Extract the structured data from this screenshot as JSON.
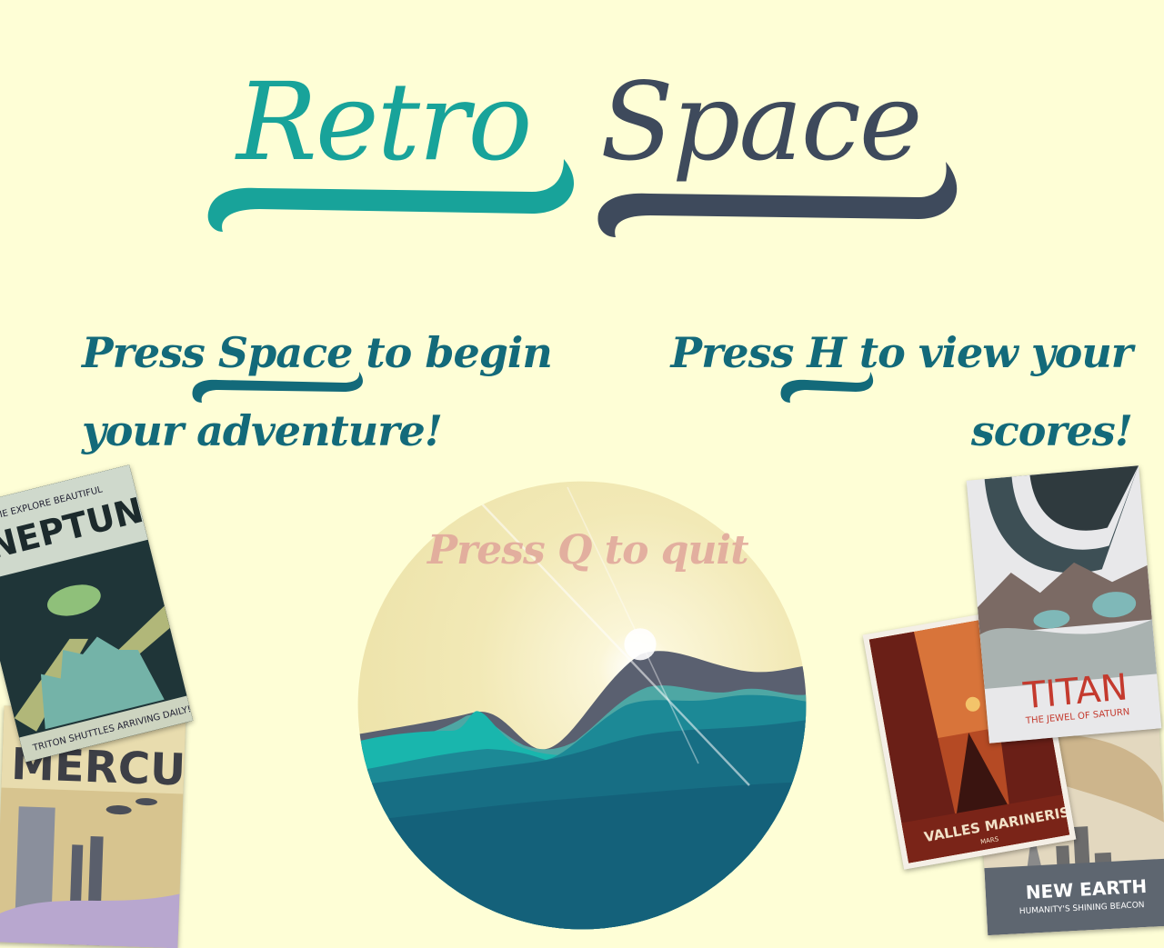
{
  "title": {
    "word1": "Retro",
    "word2": "Space"
  },
  "instructions": {
    "start": {
      "press": "Press",
      "key": "Space",
      "rest_line1": "to begin",
      "line2": "your adventure!"
    },
    "scores": {
      "press": "Press",
      "key": "H",
      "rest_line1": "to view your",
      "line2": "scores!"
    },
    "quit": "Press Q to quit"
  },
  "posters": {
    "neptune": {
      "top": "COME EXPLORE BEAUTIFUL",
      "name": "NEPTUNE",
      "tagline": "TRITON SHUTTLES ARRIVING DAILY!"
    },
    "mercury": {
      "name": "MERCURY"
    },
    "valles": {
      "name": "VALLES MARINERIS",
      "sub": "MARS"
    },
    "titan": {
      "name": "TITAN",
      "sub": "THE JEWEL OF SATURN"
    },
    "newearth": {
      "name": "NEW EARTH",
      "sub": "HUMANITY'S SHINING BEACON"
    }
  },
  "colors": {
    "background": "#fefed6",
    "teal": "#18a39a",
    "slate": "#3e4a5c",
    "text": "#136a7a",
    "quit": "#e0a59a"
  }
}
